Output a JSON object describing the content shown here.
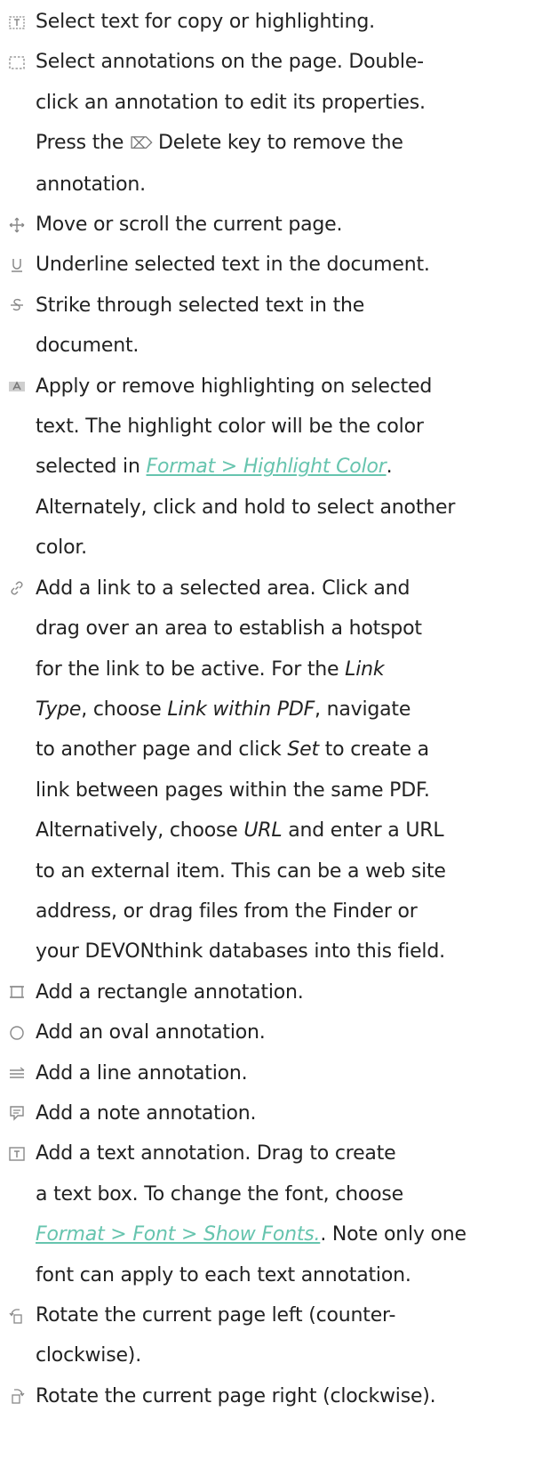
{
  "items": [
    {
      "icon": "select-text-icon",
      "lines": [
        "Select text for copy or highlighting."
      ]
    },
    {
      "icon": "select-annotation-icon",
      "lines": [
        "Select annotations on the page. Double-",
        "click an annotation to edit its properties."
      ],
      "line3": {
        "before": "Press the ",
        "delete_symbol": "⌦",
        "after": " Delete key to remove the"
      },
      "line4": "annotation."
    },
    {
      "icon": "move-icon",
      "lines": [
        "Move or scroll the current page."
      ]
    },
    {
      "icon": "underline-icon",
      "lines": [
        "Underline selected text in the document."
      ]
    },
    {
      "icon": "strikethrough-icon",
      "lines": [
        "Strike through selected text in the",
        "document."
      ]
    },
    {
      "icon": "highlight-icon",
      "lines": [
        "Apply or remove highlighting on selected",
        "text. The highlight color will be the color"
      ],
      "line3": {
        "before": "selected in ",
        "link": "Format > Highlight Color",
        "after": "."
      },
      "lines_after": [
        "Alternately, click and hold to select another",
        "color."
      ]
    },
    {
      "icon": "link-icon",
      "lines": [
        "Add a link to a selected area. Click and",
        "drag over an area to establish a hotspot"
      ],
      "line3": {
        "before": "for the link to be active. For the ",
        "em": "Link"
      },
      "line4": {
        "em1": "Type",
        "mid": ", choose ",
        "em2": "Link within PDF",
        "after": ", navigate"
      },
      "line5": {
        "before": "to another page and click ",
        "em": "Set",
        "after": " to create a"
      },
      "lines_after": [
        "link between pages within the same PDF."
      ],
      "line7": {
        "before": "Alternatively, choose ",
        "em": "URL",
        "after": " and enter a URL"
      },
      "lines_tail": [
        "to an external item. This can be a web site",
        "address, or drag files from the Finder or",
        "your DEVONthink databases into this field."
      ]
    },
    {
      "icon": "rectangle-icon",
      "lines": [
        "Add a rectangle annotation."
      ]
    },
    {
      "icon": "oval-icon",
      "lines": [
        "Add an oval annotation."
      ]
    },
    {
      "icon": "line-icon",
      "lines": [
        "Add a line annotation."
      ]
    },
    {
      "icon": "note-icon",
      "lines": [
        "Add a note annotation."
      ]
    },
    {
      "icon": "text-box-icon",
      "lines": [
        "Add a text annotation. Drag to create",
        "a text box. To change the font, choose"
      ],
      "line3": {
        "link": "Format > Font > Show Fonts.",
        "after": ". Note only one"
      },
      "lines_after": [
        "font can apply to each text annotation."
      ]
    },
    {
      "icon": "rotate-left-icon",
      "lines": [
        "Rotate the current page left (counter-",
        "clockwise)."
      ]
    },
    {
      "icon": "rotate-right-icon",
      "lines": [
        "Rotate the current page right (clockwise)."
      ]
    }
  ],
  "colors": {
    "text": "#222222",
    "link": "#66c4ae",
    "icon": "#888888"
  }
}
